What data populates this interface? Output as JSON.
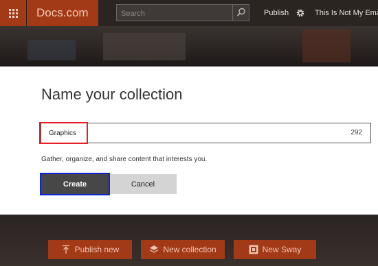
{
  "header": {
    "brand": "Docs.com",
    "search": {
      "placeholder": "Search"
    },
    "publish_label": "Publish",
    "user_label": "This Is Not My Email"
  },
  "dialog": {
    "title": "Name your collection",
    "name_field": {
      "value": "Graphics",
      "remaining_chars": "292"
    },
    "helper_text": "Gather, organize, and share content that interests you.",
    "create_label": "Create",
    "cancel_label": "Cancel"
  },
  "actions": {
    "publish_new_label": "Publish new",
    "new_collection_label": "New collection",
    "new_sway_label": "New Sway"
  },
  "colors": {
    "brand": "#a33a17",
    "highlight_red": "#e51e25",
    "highlight_blue": "#0b24d6"
  },
  "icons": [
    "app-launcher-icon",
    "search-icon",
    "gear-icon",
    "upload-icon",
    "layers-icon",
    "sway-icon"
  ]
}
